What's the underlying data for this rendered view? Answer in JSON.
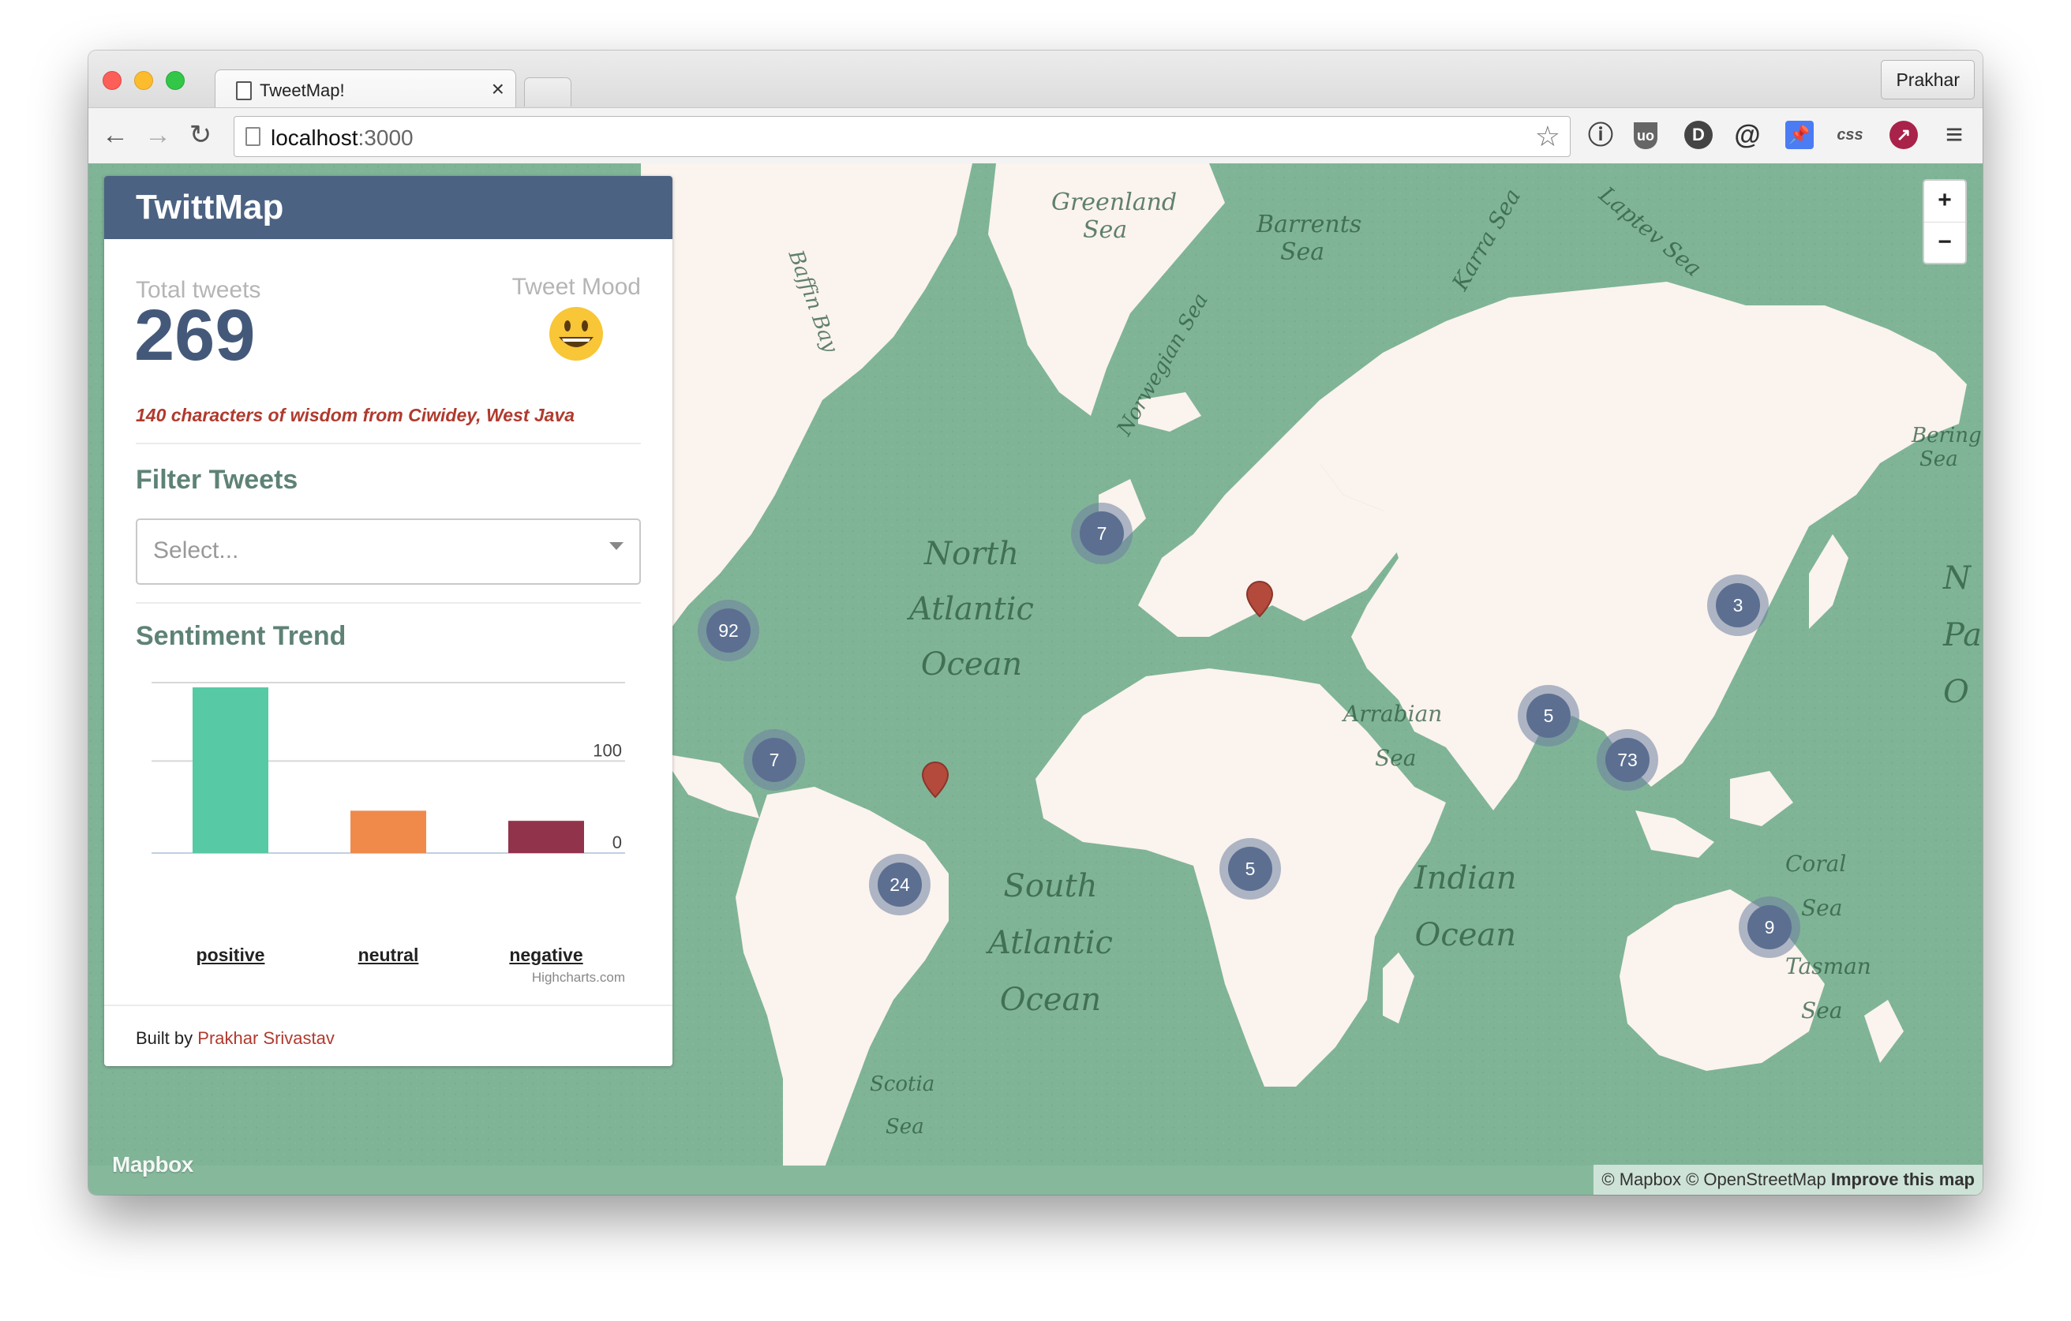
{
  "browser": {
    "tab_title": "TweetMap!",
    "tab_close": "×",
    "profile": "Prakhar",
    "url_host": "localhost",
    "url_port": ":3000",
    "nav": {
      "back": "←",
      "forward": "→",
      "reload": "↻",
      "bookmark": "☆",
      "menu": "≡"
    },
    "extensions": [
      "ⓘ",
      "uo",
      "D",
      "@",
      "📌",
      "css",
      "↗"
    ]
  },
  "panel": {
    "title": "TwittMap",
    "total_label": "Total tweets",
    "total_value": "269",
    "mood_label": "Tweet Mood",
    "mood_icon": "happy-face",
    "latest_tweet": "140 characters of wisdom from Ciwidey, West Java",
    "filter_title": "Filter Tweets",
    "filter_placeholder": "Select...",
    "trend_title": "Sentiment Trend",
    "credits": "Highcharts.com",
    "built_prefix": "Built by ",
    "built_author": "Prakhar Srivastav"
  },
  "chart_data": {
    "type": "bar",
    "categories": [
      "positive",
      "neutral",
      "negative"
    ],
    "values": [
      180,
      46,
      35
    ],
    "colors": [
      "#57c9a4",
      "#ef8a4b",
      "#92334c"
    ],
    "yticks": [
      0,
      100
    ],
    "ylim": [
      0,
      200
    ],
    "grid": true,
    "legend": "none"
  },
  "map": {
    "clusters": [
      {
        "label": "92",
        "value": 92
      },
      {
        "label": "7",
        "value": 7
      },
      {
        "label": "7",
        "value": 7
      },
      {
        "label": "24",
        "value": 24
      },
      {
        "label": "5",
        "value": 5
      },
      {
        "label": "5",
        "value": 5
      },
      {
        "label": "73",
        "value": 73
      },
      {
        "label": "3",
        "value": 3
      },
      {
        "label": "9",
        "value": 9
      }
    ],
    "pin_color": "#b34a3c",
    "zoom_in": "+",
    "zoom_out": "−",
    "logo": "Mapbox",
    "attribution_1": "© Mapbox © OpenStreetMap ",
    "attribution_2": "Improve this map",
    "labels": {
      "greenland_sea_1": "Greenland",
      "greenland_sea_2": "Sea",
      "barents_1": "Barrents",
      "barents_2": "Sea",
      "karra": "Karra Sea",
      "laptev": "Laptev Sea",
      "baffin": "Baffin Bay",
      "norwegian": "Norwegian Sea",
      "bering_1": "Bering",
      "bering_2": "Sea",
      "north_1": "North",
      "north_2": "Atlantic",
      "north_3": "Ocean",
      "arabian_1": "Arrabian",
      "arabian_2": "Sea",
      "south_1": "South",
      "south_2": "Atlantic",
      "south_3": "Ocean",
      "indian_1": "Indian",
      "indian_2": "Ocean",
      "coral_1": "Coral",
      "coral_2": "Sea",
      "tasman_1": "Tasman",
      "tasman_2": "Sea",
      "scotia_1": "Scotia",
      "scotia_2": "Sea",
      "np_1": "N",
      "np_2": "Pa",
      "np_3": "O"
    }
  }
}
